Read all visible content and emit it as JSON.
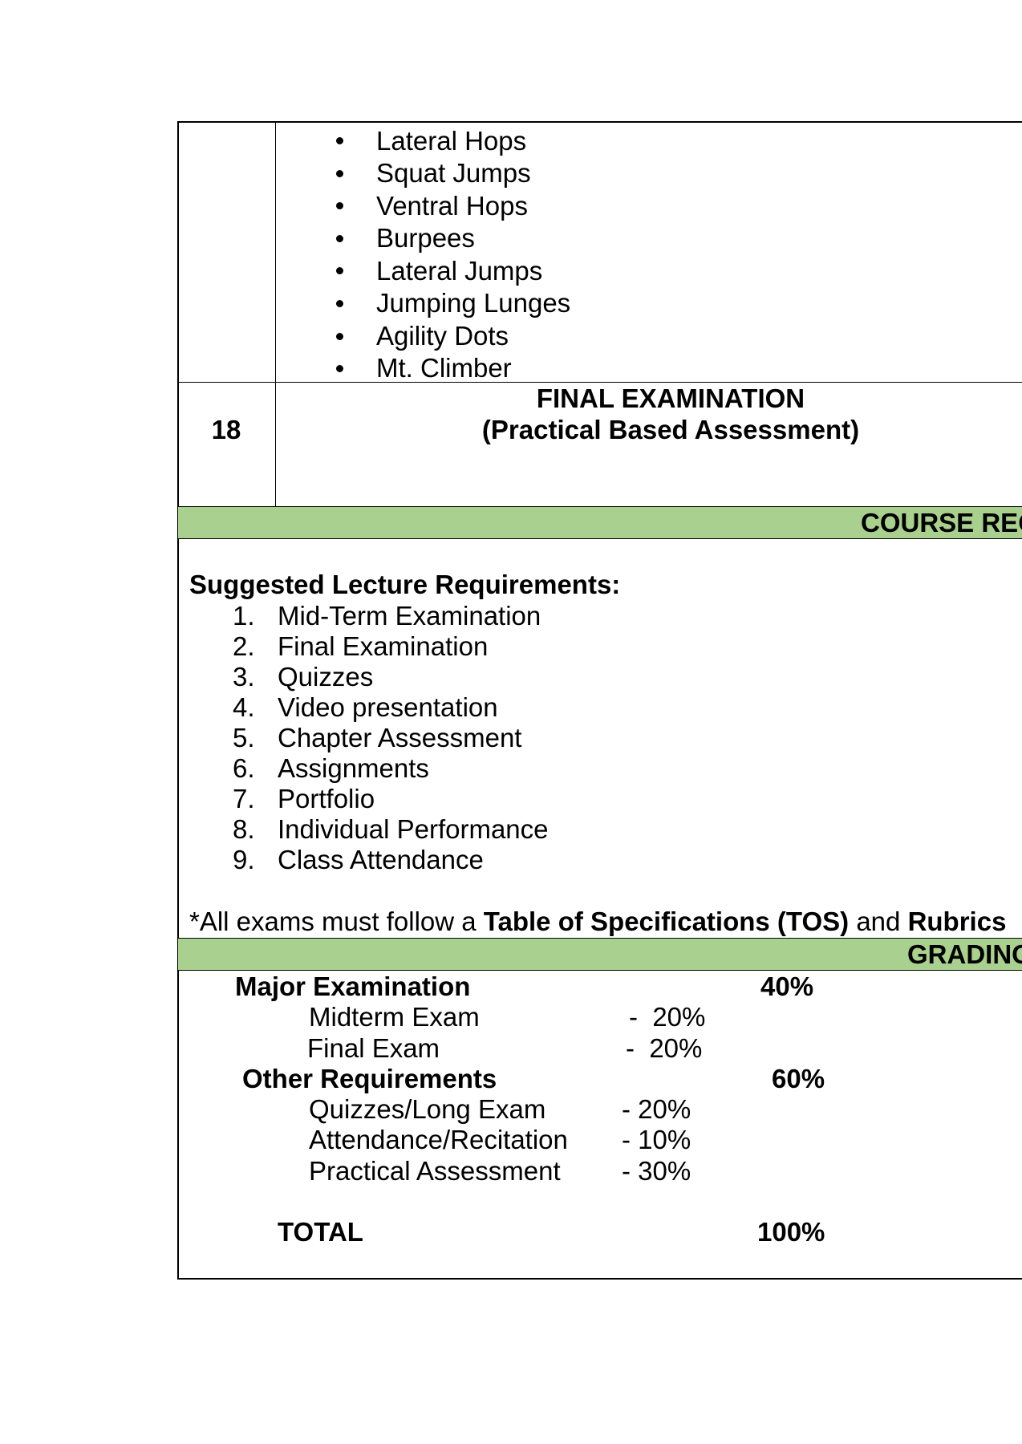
{
  "exercises": [
    "Lateral Hops",
    "Squat Jumps",
    "Ventral Hops",
    "Burpees",
    "Lateral Jumps",
    "Jumping Lunges",
    "Agility Dots",
    "Mt. Climber"
  ],
  "final_row": {
    "week": "18",
    "title": "FINAL EXAMINATION",
    "subtitle": "(Practical Based Assessment)"
  },
  "course_requirements": {
    "header": "COURSE REQ",
    "heading": "Suggested Lecture Requirements:",
    "items": [
      {
        "num": "1.",
        "label": "Mid-Term Examination"
      },
      {
        "num": "2.",
        "label": "Final Examination"
      },
      {
        "num": "3.",
        "label": "Quizzes"
      },
      {
        "num": "4.",
        "label": "Video presentation"
      },
      {
        "num": "5.",
        "label": "Chapter Assessment"
      },
      {
        "num": "6.",
        "label": "Assignments"
      },
      {
        "num": "7.",
        "label": "Portfolio"
      },
      {
        "num": "8.",
        "label": "Individual Performance"
      },
      {
        "num": "9.",
        "label": "Class Attendance"
      }
    ],
    "note_prefix": "*All exams must follow a ",
    "note_tos": "Table of Specifications (TOS)",
    "note_and": " and ",
    "note_rubrics": "Rubrics"
  },
  "grading": {
    "header": "GRADING",
    "major": {
      "label": "Major Examination",
      "total": "40%"
    },
    "midterm": {
      "label": "Midterm Exam",
      "value": "-  20%"
    },
    "final": {
      "label": "Final Exam",
      "value": "-  20%"
    },
    "other": {
      "label": "Other Requirements",
      "total": "60%"
    },
    "quizzes": {
      "label": "Quizzes/Long Exam",
      "value": "- 20%"
    },
    "attendance": {
      "label": "Attendance/Recitation",
      "value": "- 10%"
    },
    "practical": {
      "label": "Practical Assessment",
      "value": "- 30%"
    },
    "total": {
      "label": "TOTAL",
      "value": "100%"
    }
  }
}
